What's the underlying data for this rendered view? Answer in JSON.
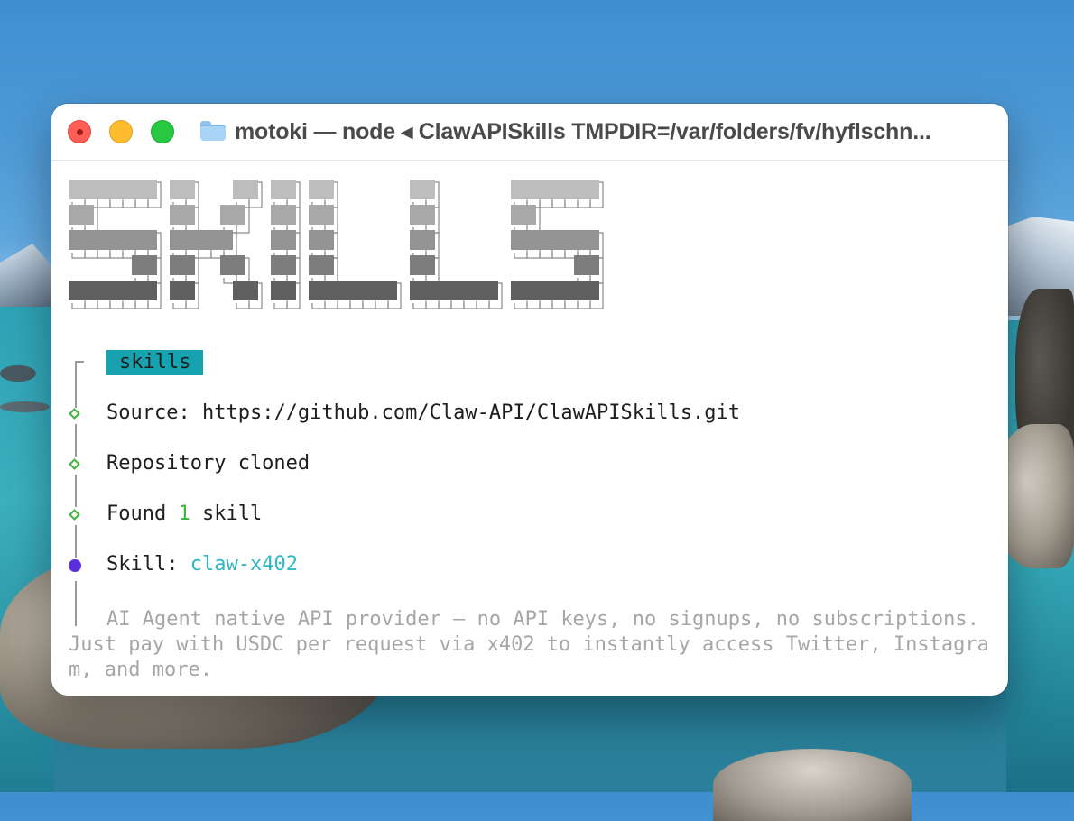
{
  "window": {
    "title": "motoki — node ◂ ClawAPISkills TMPDIR=/var/folders/fv/hyflschn...",
    "traffic_lights": [
      "close",
      "minimize",
      "zoom"
    ],
    "folder_icon": "folder-icon"
  },
  "terminal": {
    "banner_word": "SKILLS",
    "tag_label": "skills",
    "source_label": "Source:",
    "source_url": "https://github.com/Claw-API/ClawAPISkills.git",
    "repo_status": "Repository cloned",
    "found_prefix": "Found",
    "found_count": "1",
    "found_suffix": "skill",
    "skill_label": "Skill:",
    "skill_name": "claw-x402",
    "description": "AI Agent native API provider — no API keys, no signups, no subscriptions. Just pay with USDC per request via x402 to instantly access Twitter, Instagram, and more."
  },
  "colors": {
    "tag_bg": "#17a2b0",
    "success_green": "#3cb43c",
    "skill_cyan": "#2fb7c2",
    "active_dot": "#5a2fd9",
    "muted_text": "#a6a6a6"
  }
}
